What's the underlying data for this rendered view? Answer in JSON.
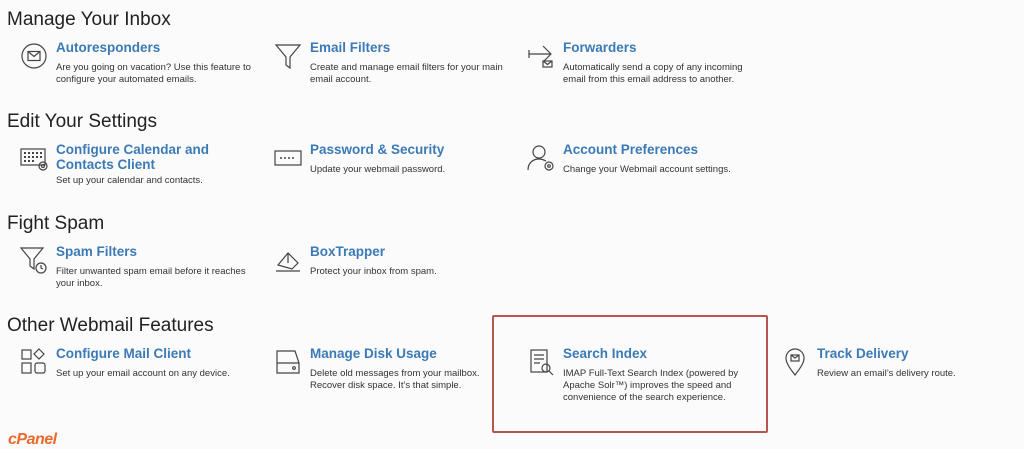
{
  "sections": {
    "manage": "Manage Your Inbox",
    "settings": "Edit Your Settings",
    "spam": "Fight Spam",
    "other": "Other Webmail Features"
  },
  "items": {
    "autoresponders": {
      "title": "Autoresponders",
      "desc": "Are you going on vacation? Use this feature to configure your automated emails."
    },
    "email_filters": {
      "title": "Email Filters",
      "desc": "Create and manage email filters for your main email account."
    },
    "forwarders": {
      "title": "Forwarders",
      "desc": "Automatically send a copy of any incoming email from this email address to another."
    },
    "calendar": {
      "title": "Configure Calendar and Contacts Client",
      "desc": "Set up your calendar and contacts."
    },
    "password": {
      "title": "Password & Security",
      "desc": "Update your webmail password."
    },
    "account_prefs": {
      "title": "Account Preferences",
      "desc": "Change your Webmail account settings."
    },
    "spam_filters": {
      "title": "Spam Filters",
      "desc": "Filter unwanted spam email before it reaches your inbox."
    },
    "boxtrapper": {
      "title": "BoxTrapper",
      "desc": "Protect your inbox from spam."
    },
    "mail_client": {
      "title": "Configure Mail Client",
      "desc": "Set up your email account on any device."
    },
    "disk_usage": {
      "title": "Manage Disk Usage",
      "desc": "Delete old messages from your mailbox. Recover disk space. It’s that simple."
    },
    "search_index": {
      "title": "Search Index",
      "desc": "IMAP Full-Text Search Index (powered by Apache Solr™) improves the speed and convenience of the search experience."
    },
    "track_delivery": {
      "title": "Track Delivery",
      "desc": "Review an email’s delivery route."
    }
  },
  "footer": {
    "logo": "cPanel"
  },
  "colors": {
    "link": "#3b7ab6",
    "highlight_border": "#b5574f"
  }
}
